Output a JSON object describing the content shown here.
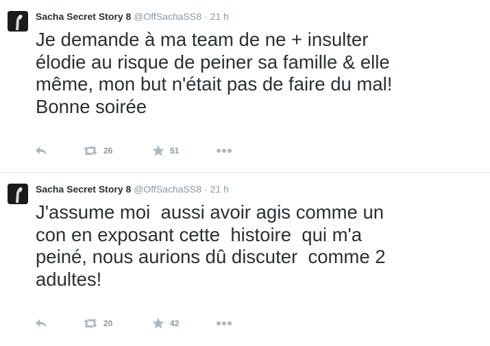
{
  "tweets": [
    {
      "fullname": "Sacha Secret Story 8",
      "handle": "@OffSachaSS8",
      "separator": "·",
      "time": "21 h",
      "text": "Je demande à ma team de ne + insulter\nélodie au risque de peiner sa famille & elle\nmême, mon but n'était pas de faire du mal!\nBonne soirée",
      "retweets": "26",
      "favorites": "51"
    },
    {
      "fullname": "Sacha Secret Story 8",
      "handle": "@OffSachaSS8",
      "separator": "·",
      "time": "21 h",
      "text": "J'assume moi  aussi avoir agis comme un\ncon en exposant cette  histoire  qui m'a\npeiné, nous aurions dû discuter  comme 2\nadultes!",
      "retweets": "20",
      "favorites": "42"
    }
  ],
  "icons": {
    "reply": "reply-icon",
    "retweet": "retweet-icon",
    "favorite": "star-icon",
    "more": "more-dots-icon"
  },
  "colors": {
    "text": "#292f33",
    "muted": "#8899a6",
    "icon": "#aab8c2",
    "divider": "#e1e8ed"
  }
}
